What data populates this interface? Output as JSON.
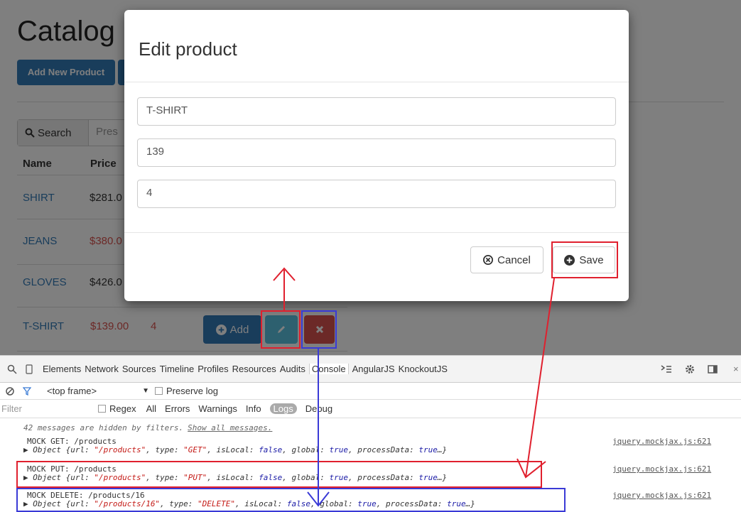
{
  "page": {
    "title": "Catalog",
    "add_new_button": "Add New Product",
    "search_label": "Search",
    "search_placeholder": "Pres",
    "headers": {
      "name": "Name",
      "price": "Price"
    },
    "rows": [
      {
        "name": "SHIRT",
        "price": "$281.0",
        "qty": ""
      },
      {
        "name": "JEANS",
        "price": "$380.0",
        "qty": ""
      },
      {
        "name": "GLOVES",
        "price": "$426.0",
        "qty": ""
      },
      {
        "name": "T-SHIRT",
        "price": "$139.00",
        "qty": "4"
      }
    ],
    "row_add_label": "Add"
  },
  "modal": {
    "title": "Edit product",
    "fields": [
      "T-SHIRT",
      "139",
      "4"
    ],
    "cancel_label": "Cancel",
    "save_label": "Save"
  },
  "devtools": {
    "tabs": [
      "Elements",
      "Network",
      "Sources",
      "Timeline",
      "Profiles",
      "Resources",
      "Audits",
      "Console",
      "AngularJS",
      "KnockoutJS"
    ],
    "active_tab": "Console",
    "frame_select": "<top frame>",
    "preserve_log": "Preserve log",
    "filter_placeholder": "Filter",
    "regex": "Regex",
    "levels": [
      "All",
      "Errors",
      "Warnings",
      "Info",
      "Logs",
      "Debug"
    ],
    "active_level": "Logs",
    "hidden_msg": "42 messages are hidden by filters.",
    "show_all": "Show all messages.",
    "entries": [
      {
        "head": "MOCK GET: /products",
        "url": "\"/products\"",
        "type": "\"GET\"",
        "source": "jquery.mockjax.js:621"
      },
      {
        "head": "MOCK PUT: /products",
        "url": "\"/products\"",
        "type": "\"PUT\"",
        "source": "jquery.mockjax.js:621"
      },
      {
        "head": "MOCK DELETE: /products/16",
        "url": "\"/products/16\"",
        "type": "\"DELETE\"",
        "source": "jquery.mockjax.js:621"
      }
    ],
    "obj_prefix": "▶ Object {url: ",
    "obj_type": ", type: ",
    "obj_islocal": ", isLocal: ",
    "val_false": "false",
    "obj_global": ", global: ",
    "val_true": "true",
    "obj_processdata": ", processData: ",
    "obj_end": "…}"
  },
  "colors": {
    "red_annotation": "#e0202e",
    "blue_annotation": "#3a3ad6",
    "primary": "#337ab7",
    "info": "#5bc0de",
    "danger": "#d9534f"
  }
}
